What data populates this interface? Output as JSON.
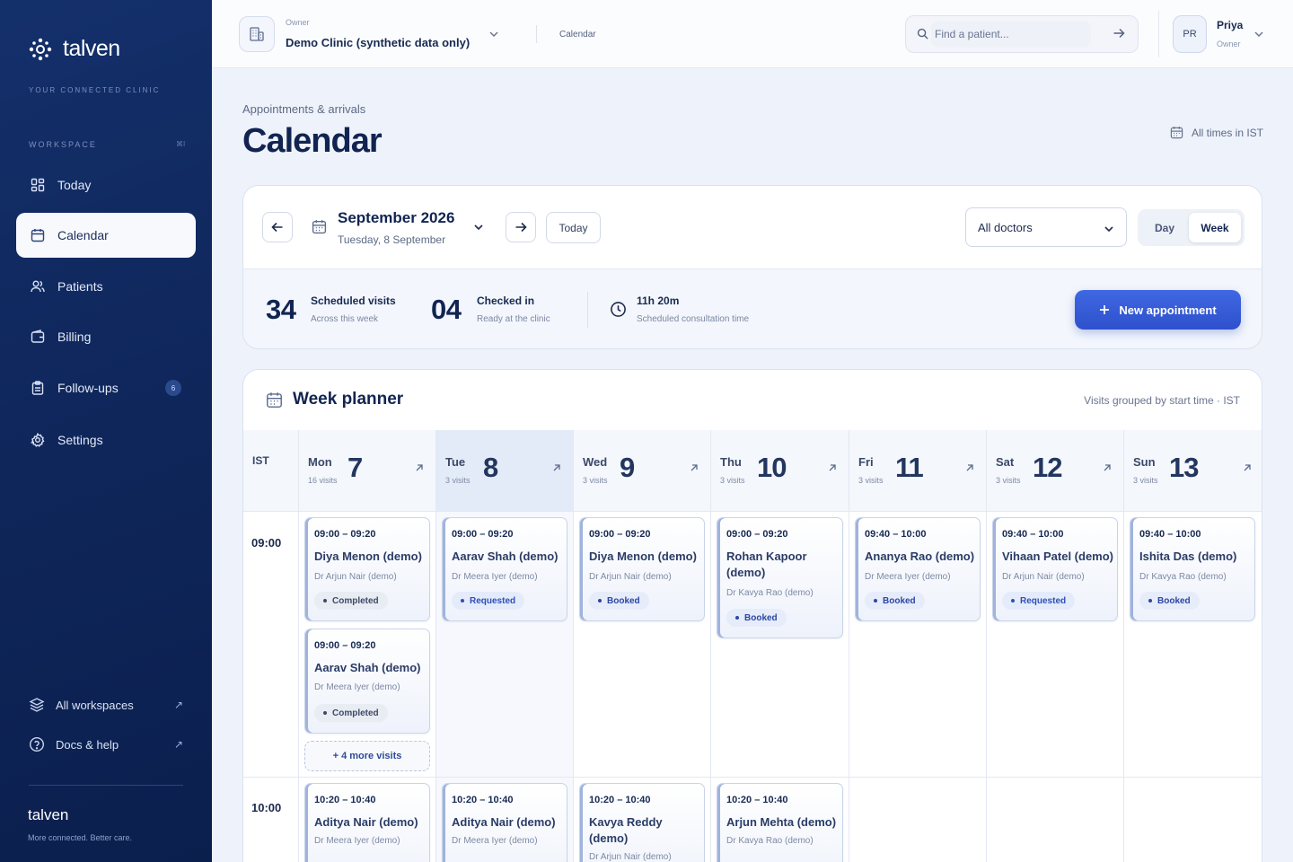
{
  "sidebar": {
    "brand": "talven",
    "tagline": "YOUR CONNECTED CLINIC",
    "workspace_label": "WORKSPACE",
    "workspace_hint": "⌘I",
    "items": [
      {
        "label": "Today",
        "icon": "grid-icon"
      },
      {
        "label": "Calendar",
        "icon": "calendar-icon",
        "active": true
      },
      {
        "label": "Patients",
        "icon": "users-icon"
      },
      {
        "label": "Billing",
        "icon": "wallet-icon"
      },
      {
        "label": "Follow-ups",
        "icon": "clipboard-icon",
        "badge": "6"
      },
      {
        "label": "Settings",
        "icon": "gear-icon"
      }
    ],
    "bottom_links": [
      {
        "label": "All workspaces",
        "icon": "layers-icon"
      },
      {
        "label": "Docs & help",
        "icon": "help-icon"
      }
    ],
    "footer_brand": "talven",
    "footer_tagline": "More connected. Better care."
  },
  "topbar": {
    "owner_label": "Owner",
    "clinic_name": "Demo Clinic (synthetic data only)",
    "breadcrumb": "Calendar",
    "search_placeholder": "Find a patient...",
    "user_initials": "PR",
    "user_name": "Priya",
    "user_role": "Owner"
  },
  "header": {
    "subtitle": "Appointments & arrivals",
    "title": "Calendar",
    "timezone_note": "All times in IST"
  },
  "controls": {
    "month": "September 2026",
    "selected_date": "Tuesday, 8 September",
    "today_label": "Today",
    "doctor_filter": "All doctors",
    "view_day": "Day",
    "view_week": "Week",
    "active_view": "Week"
  },
  "stats": {
    "scheduled_count": "34",
    "scheduled_label": "Scheduled visits",
    "scheduled_sub": "Across this week",
    "checked_count": "04",
    "checked_label": "Checked in",
    "checked_sub": "Ready at the clinic",
    "time_value": "11h 20m",
    "time_sub": "Scheduled consultation time",
    "new_button": "New appointment"
  },
  "planner": {
    "title": "Week planner",
    "note": "Visits grouped by start time · IST",
    "tz_header": "IST",
    "times": [
      "09:00",
      "10:00"
    ],
    "more_label": "+ 4 more visits",
    "days": [
      {
        "name": "Mon",
        "num": "7",
        "count": "16 visits"
      },
      {
        "name": "Tue",
        "num": "8",
        "count": "3 visits",
        "today": true
      },
      {
        "name": "Wed",
        "num": "9",
        "count": "3 visits"
      },
      {
        "name": "Thu",
        "num": "10",
        "count": "3 visits"
      },
      {
        "name": "Fri",
        "num": "11",
        "count": "3 visits"
      },
      {
        "name": "Sat",
        "num": "12",
        "count": "3 visits"
      },
      {
        "name": "Sun",
        "num": "13",
        "count": "3 visits"
      }
    ],
    "appointments": {
      "mon1": {
        "time": "09:00 – 09:20",
        "patient": "Diya Menon (demo)",
        "doctor": "Dr Arjun Nair (demo)",
        "status": "Completed"
      },
      "mon2": {
        "time": "09:00 – 09:20",
        "patient": "Aarav Shah (demo)",
        "doctor": "Dr Meera Iyer (demo)",
        "status": "Completed"
      },
      "tue1": {
        "time": "09:00 – 09:20",
        "patient": "Aarav Shah (demo)",
        "doctor": "Dr Meera Iyer (demo)",
        "status": "Requested"
      },
      "wed1": {
        "time": "09:00 – 09:20",
        "patient": "Diya Menon (demo)",
        "doctor": "Dr Arjun Nair (demo)",
        "status": "Booked"
      },
      "thu1": {
        "time": "09:00 – 09:20",
        "patient": "Rohan Kapoor (demo)",
        "doctor": "Dr Kavya Rao (demo)",
        "status": "Booked"
      },
      "fri1": {
        "time": "09:40 – 10:00",
        "patient": "Ananya Rao (demo)",
        "doctor": "Dr Meera Iyer (demo)",
        "status": "Booked"
      },
      "sat1": {
        "time": "09:40 – 10:00",
        "patient": "Vihaan Patel (demo)",
        "doctor": "Dr Arjun Nair (demo)",
        "status": "Requested"
      },
      "sun1": {
        "time": "09:40 – 10:00",
        "patient": "Ishita Das (demo)",
        "doctor": "Dr Kavya Rao (demo)",
        "status": "Booked"
      },
      "mon3": {
        "time": "10:20 – 10:40",
        "patient": "Aditya Nair (demo)",
        "doctor": "Dr Meera Iyer (demo)"
      },
      "tue2": {
        "time": "10:20 – 10:40",
        "patient": "Aditya Nair (demo)",
        "doctor": "Dr Meera Iyer (demo)"
      },
      "wed2": {
        "time": "10:20 – 10:40",
        "patient": "Kavya Reddy (demo)",
        "doctor": "Dr Arjun Nair (demo)"
      },
      "thu2": {
        "time": "10:20 – 10:40",
        "patient": "Arjun Mehta (demo)",
        "doctor": "Dr Kavya Rao (demo)"
      }
    }
  }
}
